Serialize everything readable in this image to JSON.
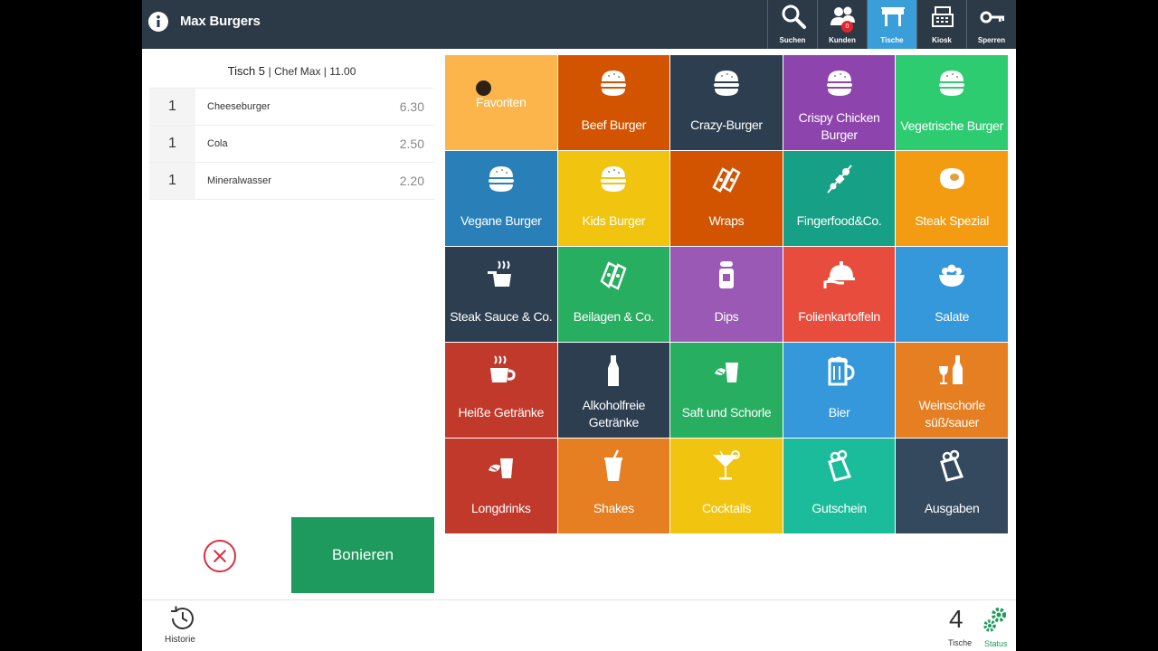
{
  "header": {
    "title": "Max Burgers",
    "info_icon": "info-icon"
  },
  "toolbar": [
    {
      "label": "Suchen",
      "icon": "search-icon",
      "active": false
    },
    {
      "label": "Kunden",
      "icon": "customers-icon",
      "active": false,
      "badge": "0"
    },
    {
      "label": "Tische",
      "icon": "tables-icon",
      "active": true
    },
    {
      "label": "Kiosk",
      "icon": "cash-register-icon",
      "active": false
    },
    {
      "label": "Sperren",
      "icon": "key-icon",
      "active": false
    }
  ],
  "order": {
    "table": "Tisch 5",
    "meta": "| Chef Max | 11.00",
    "lines": [
      {
        "qty": "1",
        "name": "Cheeseburger",
        "price": "6.30"
      },
      {
        "qty": "1",
        "name": "Cola",
        "price": "2.50"
      },
      {
        "qty": "1",
        "name": "Mineralwasser",
        "price": "2.20"
      }
    ],
    "submit_label": "Bonieren"
  },
  "categories": [
    {
      "label": "Favoriten",
      "icon": "",
      "color": "#fbb54a"
    },
    {
      "label": "Beef Burger",
      "icon": "burger-icon",
      "color": "#d35400"
    },
    {
      "label": "Crazy-Burger",
      "icon": "burger-icon",
      "color": "#2c3e50"
    },
    {
      "label": "Crispy Chicken Burger",
      "icon": "burger-icon",
      "color": "#8e44ad"
    },
    {
      "label": "Vegetrische Burger",
      "icon": "burger-icon",
      "color": "#2ecc71"
    },
    {
      "label": "Vegane Burger",
      "icon": "burger-icon",
      "color": "#2980b9"
    },
    {
      "label": "Kids Burger",
      "icon": "burger-icon",
      "color": "#f1c40f"
    },
    {
      "label": "Wraps",
      "icon": "wrap-icon",
      "color": "#d35400"
    },
    {
      "label": "Fingerfood&Co.",
      "icon": "skewer-icon",
      "color": "#16a085"
    },
    {
      "label": "Steak Spezial",
      "icon": "steak-icon",
      "color": "#f39c12"
    },
    {
      "label": "Steak Sauce & Co.",
      "icon": "saucepan-icon",
      "color": "#2c3e50"
    },
    {
      "label": "Beilagen & Co.",
      "icon": "side-dish-icon",
      "color": "#27ae60"
    },
    {
      "label": "Dips",
      "icon": "dip-jar-icon",
      "color": "#9b59b6"
    },
    {
      "label": "Folienkartoffeln",
      "icon": "cloche-icon",
      "color": "#e74c3c"
    },
    {
      "label": "Salate",
      "icon": "salad-bowl-icon",
      "color": "#3498db"
    },
    {
      "label": "Heiße Getränke",
      "icon": "hot-cup-icon",
      "color": "#c0392b"
    },
    {
      "label": "Alkoholfreie Getränke",
      "icon": "bottle-icon",
      "color": "#2c3e50"
    },
    {
      "label": "Saft und Schorle",
      "icon": "juice-glass-icon",
      "color": "#27ae60"
    },
    {
      "label": "Bier",
      "icon": "beer-mug-icon",
      "color": "#3498db"
    },
    {
      "label": "Weinschorle süß/sauer",
      "icon": "wine-icon",
      "color": "#e67e22"
    },
    {
      "label": "Longdrinks",
      "icon": "longdrink-icon",
      "color": "#c0392b"
    },
    {
      "label": "Shakes",
      "icon": "shake-cup-icon",
      "color": "#e67e22"
    },
    {
      "label": "Cocktails",
      "icon": "cocktail-icon",
      "color": "#f1c40f"
    },
    {
      "label": "Gutschein",
      "icon": "voucher-icon",
      "color": "#1abc9c"
    },
    {
      "label": "Ausgaben",
      "icon": "expenses-icon",
      "color": "#34495e"
    }
  ],
  "footer": {
    "history_label": "Historie",
    "tables_count": "4",
    "tables_label": "Tische",
    "status_label": "Status"
  }
}
